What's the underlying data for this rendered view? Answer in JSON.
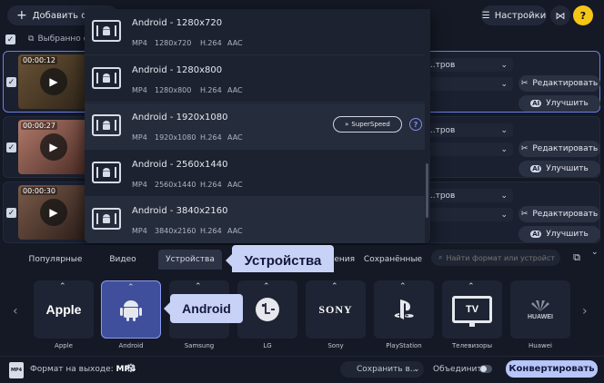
{
  "topbar": {
    "add_files_label": "Добавить фай...",
    "settings_label": "Настройки",
    "help_label": "?"
  },
  "list": {
    "selected_label": "Выбранно фа...",
    "rows": [
      {
        "duration": "00:00:12",
        "preset_select": "...тров",
        "edit_label": "Редактировать",
        "enhance_label": "Улучшить"
      },
      {
        "duration": "00:00:27",
        "preset_select": "...тров",
        "edit_label": "Редактировать",
        "enhance_label": "Улучшить"
      },
      {
        "duration": "00:00:30",
        "preset_select": "...тров",
        "edit_label": "Редактировать",
        "enhance_label": "Улучшить"
      }
    ]
  },
  "dropdown": {
    "items": [
      {
        "title": "Android - 1280x720",
        "container": "MP4",
        "resolution": "1280x720",
        "codec": "H.264",
        "audio": "AAC"
      },
      {
        "title": "Android - 1280x800",
        "container": "MP4",
        "resolution": "1280x800",
        "codec": "H.264",
        "audio": "AAC"
      },
      {
        "title": "Android - 1920x1080",
        "container": "MP4",
        "resolution": "1920x1080",
        "codec": "H.264",
        "audio": "AAC",
        "superspeed": "SuperSpeed"
      },
      {
        "title": "Android - 2560x1440",
        "container": "MP4",
        "resolution": "2560x1440",
        "codec": "H.264",
        "audio": "AAC"
      },
      {
        "title": "Android - 3840x2160",
        "container": "MP4",
        "resolution": "3840x2160",
        "codec": "H.264",
        "audio": "AAC"
      }
    ]
  },
  "tabs": {
    "popular": "Популярные",
    "video": "Видео",
    "devices": "Устройства",
    "partial": "ления",
    "saved": "Сохранённые",
    "search_placeholder": "Найти формат или устройство..."
  },
  "callouts": {
    "devices": "Устройства",
    "android": "Android"
  },
  "devices": [
    {
      "logo_text": "Apple",
      "label": "Apple"
    },
    {
      "logo_text": "",
      "label": "Android"
    },
    {
      "logo_text": "",
      "label": "Samsung"
    },
    {
      "logo_text": "",
      "label": "LG"
    },
    {
      "logo_text": "SONY",
      "label": "Sony"
    },
    {
      "logo_text": "",
      "label": "PlayStation"
    },
    {
      "logo_text": "TV",
      "label": "Телевизоры"
    },
    {
      "logo_text": "HUAWEI",
      "label": "Huawei"
    }
  ],
  "bottombar": {
    "output_icon_text": "MP4",
    "output_label": "Формат на выходе:",
    "output_value": "MP4",
    "save_label": "Сохранить в...",
    "merge_label": "Объединить:",
    "convert_label": "Конвертировать"
  },
  "colors": {
    "accent": "#b7c6fa",
    "active_tile": "#3f4f9c",
    "callout": "#c8d2f7",
    "help": "#f5c518"
  }
}
